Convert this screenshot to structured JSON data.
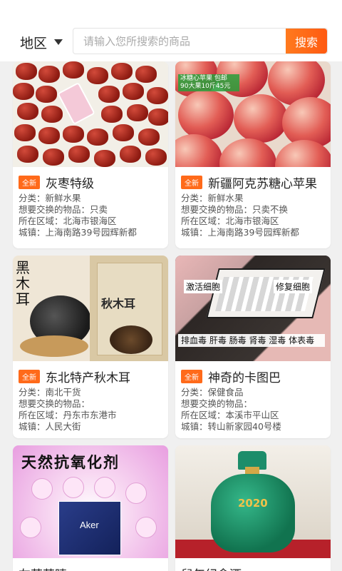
{
  "header": {
    "region_label": "地区",
    "search_placeholder": "请输入您所搜索的商品",
    "search_button": "搜索"
  },
  "labels": {
    "category": "分类：",
    "exchange": "想要交换的物品：",
    "area": "所在区域：",
    "town": "城镇："
  },
  "products": [
    {
      "badge": "全新",
      "title": "灰枣特级",
      "category": "新鲜水果",
      "exchange": "只卖",
      "area": "北海市银海区",
      "town": "上海南路39号园辉新都"
    },
    {
      "badge": "全新",
      "title": "新疆阿克苏糖心苹果",
      "thumb_tag": "冰糖心苹果 包邮 90大果10斤45元",
      "category": "新鲜水果",
      "exchange": "只卖不换",
      "area": "北海市银海区",
      "town": "上海南路39号园辉新都"
    },
    {
      "badge": "全新",
      "title": "东北特产秋木耳",
      "thumb_text_1": "黑木耳",
      "thumb_text_2": "秋木耳",
      "category": "南北干货",
      "exchange": "",
      "area": "丹东市东港市",
      "town": "人民大街"
    },
    {
      "badge": "全新",
      "title": "神奇的卡图巴",
      "thumb_text_1": "激活细胞",
      "thumb_text_2": "修复细胞",
      "thumb_text_3": "排血毒 肝毒 肠毒 肾毒 湿毒 体表毒",
      "category": "保健食品",
      "exchange": "",
      "area": "本溪市平山区",
      "town": "转山新家园40号楼"
    },
    {
      "title": "左营营睛",
      "thumb_text_1": "天然抗氧化剂",
      "thumb_text_2": "Aker"
    },
    {
      "title": "鼠年纪念酒",
      "thumb_text_1": "2020"
    }
  ]
}
